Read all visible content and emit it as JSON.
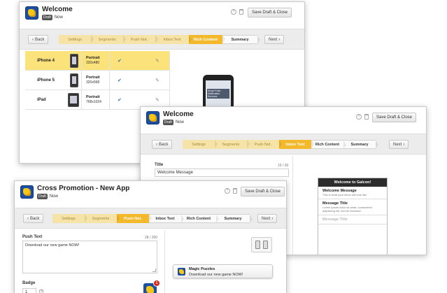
{
  "window1": {
    "title": "Welcome",
    "status_badge": "Draft",
    "status_time": "Now",
    "help_icon": "?",
    "save_label": "Save Draft & Close",
    "back_label": "Back",
    "next_label": "Next",
    "steps": [
      "Settings",
      "Segments",
      "Push Not.",
      "Inbox Text",
      "Rich Content",
      "Summary"
    ],
    "devices": [
      {
        "name": "iPhone 4",
        "orientation": "Portrait",
        "resolution": "320x480"
      },
      {
        "name": "iPhone 5",
        "orientation": "Portrait",
        "resolution": "320x568"
      },
      {
        "name": "iPad",
        "orientation": "Portrait",
        "resolution": "768x1024"
      }
    ],
    "preview_text": "Smart Push Notification Services"
  },
  "window2": {
    "title": "Welcome",
    "status_badge": "Draft",
    "status_time": "Now",
    "help_icon": "?",
    "save_label": "Save Draft & Close",
    "back_label": "Back",
    "next_label": "Next",
    "steps": [
      "Settings",
      "Segments",
      "Push Not.",
      "Inbox Text",
      "Rich Content",
      "Summary"
    ],
    "title_label": "Title",
    "title_counter": "15 / 30",
    "title_value": "Welcome Message",
    "inbox": {
      "header": "Welcome to Galcon!",
      "items": [
        {
          "title": "Welcome Message",
          "desc": "This is what your inbox will look like."
        },
        {
          "title": "Message Title",
          "desc": "Lorem ipsum dolor sit amet, consectetur adipiscing elit, sed do eiusmod."
        },
        {
          "title": "Message Title",
          "desc": ""
        }
      ]
    }
  },
  "window3": {
    "title": "Cross Promotion - New App",
    "status_badge": "Draft",
    "status_time": "Now",
    "help_icon": "?",
    "save_label": "Save Draft & Close",
    "back_label": "Back",
    "next_label": "Next",
    "steps": [
      "Settings",
      "Segments",
      "Push Not.",
      "Inbox Text",
      "Rich Content",
      "Summary"
    ],
    "push_label": "Push Text",
    "push_counter": "28 / 200",
    "push_value": "Download our new game NOW!",
    "badge_label": "Badge",
    "badge_value": "1",
    "badge_help": "(?)",
    "notification": {
      "title": "Magic Puzzles",
      "message": "Download our new game NOW!"
    },
    "app_badge": "1"
  },
  "colors": {
    "accent": "#f4b92b",
    "step_done": "#f6e3a8",
    "selected_row": "#fbe27a",
    "logo_blue": "#1c4fa3"
  }
}
